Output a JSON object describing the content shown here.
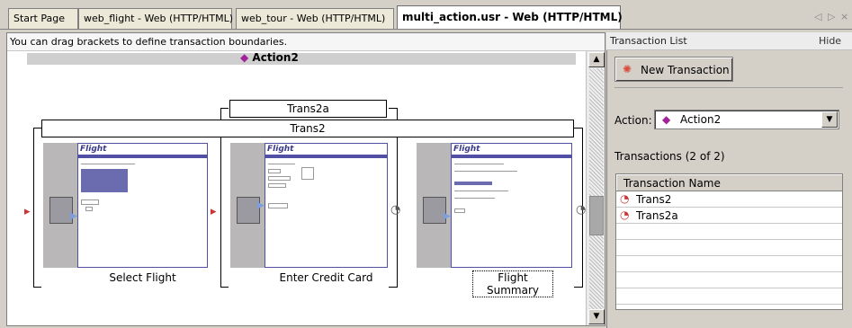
{
  "tabs": [
    {
      "label": "Start Page"
    },
    {
      "label": "web_flight - Web (HTTP/HTML)"
    },
    {
      "label": "web_tour - Web (HTTP/HTML)"
    },
    {
      "label": "multi_action.usr - Web (HTTP/HTML)",
      "active": true
    }
  ],
  "tab_nav": {
    "prev": "◁",
    "next": "▷",
    "close": "×"
  },
  "editor": {
    "hint": "You can drag brackets to define transaction boundaries.",
    "action_title": "Action2",
    "brackets": [
      {
        "label": "Trans2a"
      },
      {
        "label": "Trans2"
      }
    ],
    "steps": [
      {
        "label": "Select Flight",
        "logo": "Flight"
      },
      {
        "label": "Enter Credit Card",
        "logo": "Flight"
      },
      {
        "label": "Flight Summary",
        "logo": "Flight"
      }
    ]
  },
  "right_panel": {
    "title": "Transaction List",
    "hide": "Hide",
    "new_transaction": "New Transaction",
    "action_label": "Action:",
    "action_value": "Action2",
    "transactions_count": "Transactions (2 of 2)",
    "column_header": "Transaction Name",
    "transactions": [
      "Trans2",
      "Trans2a"
    ]
  },
  "colors": {
    "accent": "#5250a5",
    "action_icon": "#a2229a"
  }
}
